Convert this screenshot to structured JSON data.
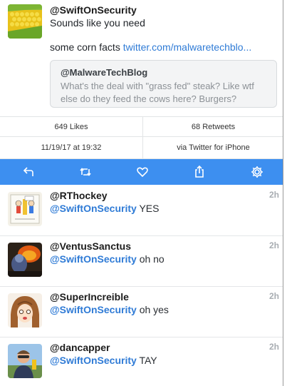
{
  "tweet": {
    "handle": "@SwiftOnSecurity",
    "line1": "Sounds like you need",
    "line2": "some corn facts",
    "link": "twitter.com/malwaretechblo...",
    "quote": {
      "handle": "@MalwareTechBlog",
      "text": "What's the deal with \"grass fed\" steak? Like wtf else do they feed the cows here? Burgers?"
    },
    "likes": "649 Likes",
    "retweets": "68 Retweets",
    "timestamp": "11/19/17 at 19:32",
    "via": "via Twitter for iPhone"
  },
  "toolbar": {
    "icons": [
      "reply-icon",
      "retweet-icon",
      "heart-icon",
      "share-icon",
      "gear-icon"
    ]
  },
  "replies": [
    {
      "handle": "@RThockey",
      "mention": "@SwiftOnSecurity",
      "text": "YES",
      "time": "2h"
    },
    {
      "handle": "@VentusSanctus",
      "mention": "@SwiftOnSecurity",
      "text": "oh no",
      "time": "2h"
    },
    {
      "handle": "@SuperIncreible",
      "mention": "@SwiftOnSecurity",
      "text": "oh yes",
      "time": "2h"
    },
    {
      "handle": "@dancapper",
      "mention": "@SwiftOnSecurity",
      "text": "TAY",
      "time": "2h"
    }
  ],
  "colors": {
    "accent": "#3d8ff0",
    "link": "#2f7bd6"
  }
}
